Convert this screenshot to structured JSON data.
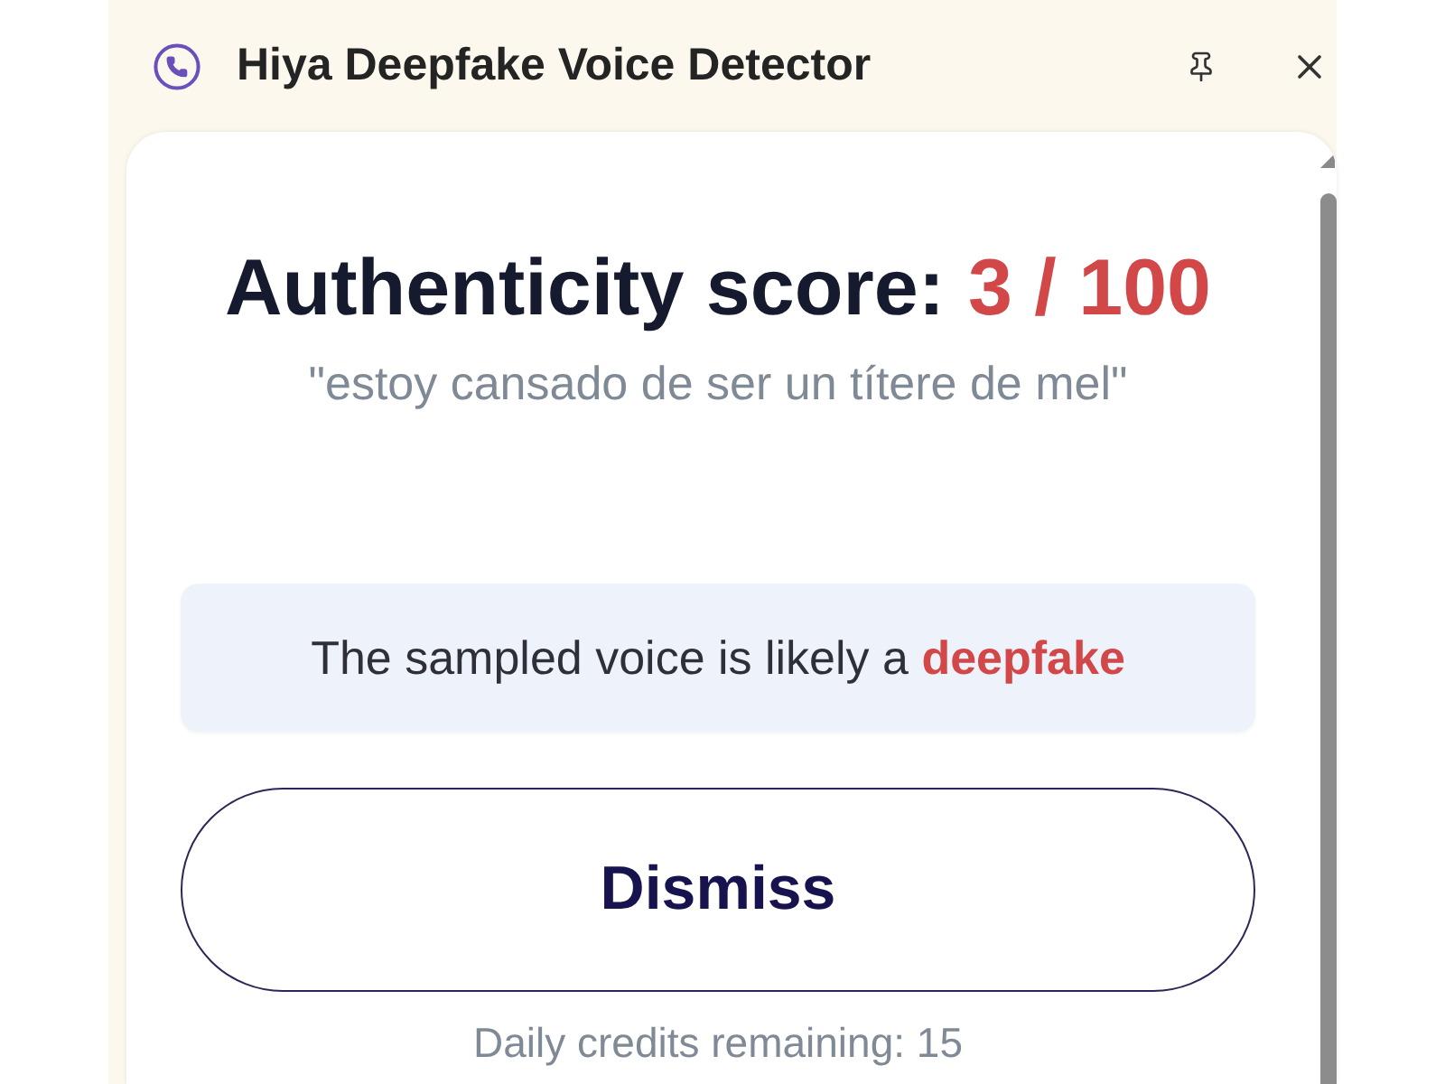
{
  "window": {
    "title": "Hiya Deepfake Voice Detector"
  },
  "result": {
    "heading": "Authenticity score:",
    "score": "3 / 100",
    "transcript": "\"estoy cansado de ser un títere de mel\"",
    "verdict": "The sampled voice is likely a **deepfake**"
  },
  "buttons": [
    {
      "label": "Dismiss"
    }
  ],
  "footer": {
    "credits": "Daily credits remaining: 15"
  }
}
